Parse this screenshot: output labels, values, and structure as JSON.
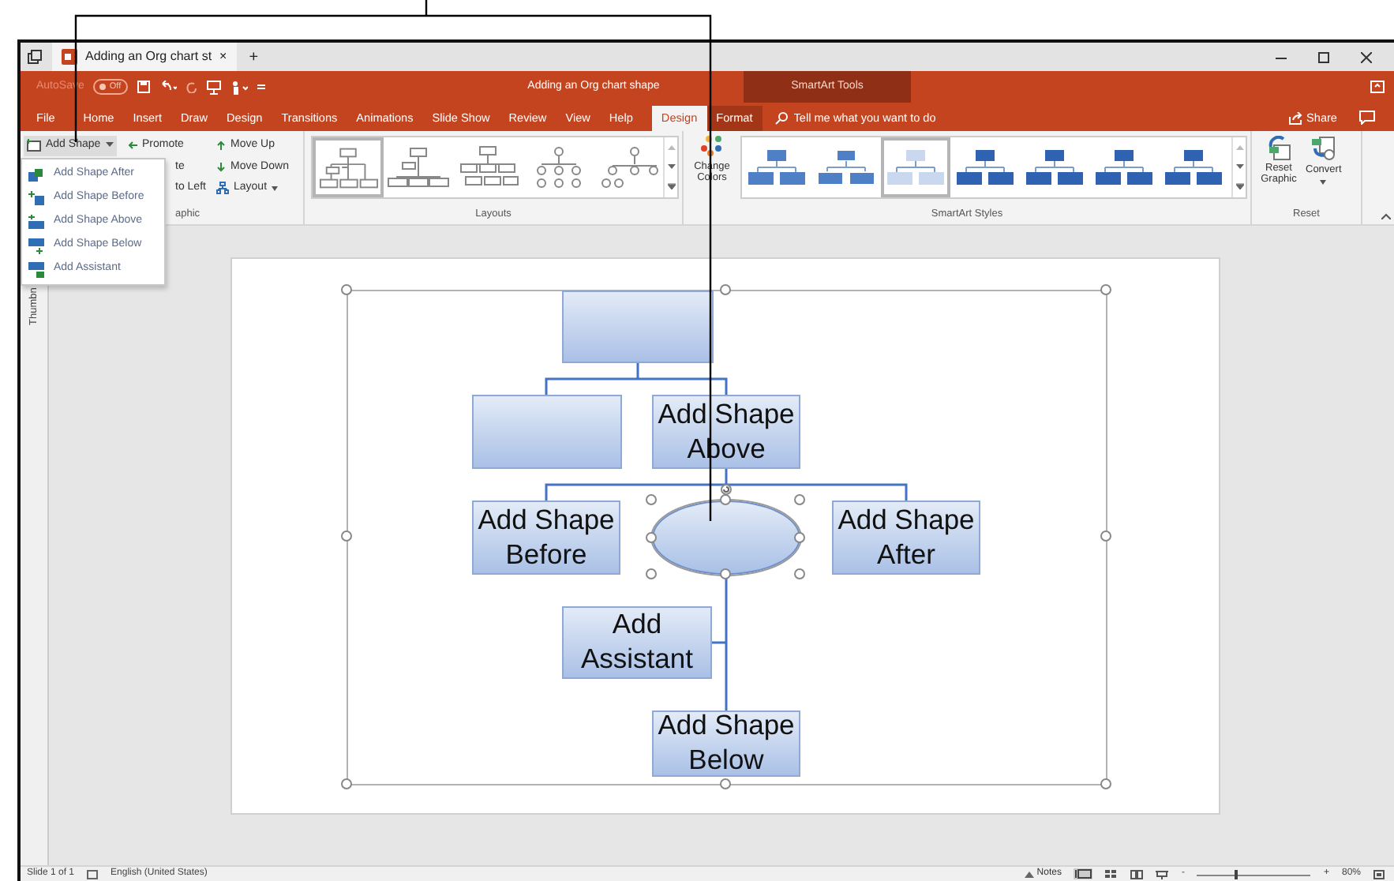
{
  "tab_bar": {
    "document_tab": "Adding an Org chart st",
    "close_glyph": "×",
    "new_tab": "+"
  },
  "title_bar": {
    "autosave_label": "AutoSave",
    "autosave_on": false,
    "autosave_state": "Off",
    "title": "Adding an Org chart shape",
    "contextual_label": "SmartArt Tools"
  },
  "ribbon_tabs": [
    {
      "label": "File",
      "selected": false,
      "kind": "main"
    },
    {
      "label": "Home",
      "selected": false,
      "kind": "main"
    },
    {
      "label": "Insert",
      "selected": false,
      "kind": "main"
    },
    {
      "label": "Draw",
      "selected": false,
      "kind": "main"
    },
    {
      "label": "Design",
      "selected": false,
      "kind": "main"
    },
    {
      "label": "Transitions",
      "selected": false,
      "kind": "main"
    },
    {
      "label": "Animations",
      "selected": false,
      "kind": "main"
    },
    {
      "label": "Slide Show",
      "selected": false,
      "kind": "main"
    },
    {
      "label": "Review",
      "selected": false,
      "kind": "main"
    },
    {
      "label": "View",
      "selected": false,
      "kind": "main"
    },
    {
      "label": "Help",
      "selected": false,
      "kind": "main"
    },
    {
      "label": "Design",
      "selected": true,
      "kind": "contextual"
    },
    {
      "label": "Format",
      "selected": false,
      "kind": "contextual"
    }
  ],
  "search": {
    "placeholder": "Tell me what you want to do"
  },
  "share": "Share",
  "create_graphic": {
    "add_shape": "Add Shape",
    "promote": "Promote",
    "demote": "te",
    "right_to_left": "to Left",
    "move_up": "Move Up",
    "move_down": "Move Down",
    "layout": "Layout",
    "group_label": "aphic"
  },
  "layouts": {
    "group_label": "Layouts",
    "items": [
      {
        "selected": true
      },
      {
        "selected": false
      },
      {
        "selected": false
      },
      {
        "selected": false
      },
      {
        "selected": false
      }
    ]
  },
  "smartart_styles": {
    "change_colors": "Change Colors",
    "group_label": "SmartArt Styles",
    "items": [
      {
        "selected": false
      },
      {
        "selected": false
      },
      {
        "selected": true
      },
      {
        "selected": false
      },
      {
        "selected": false
      },
      {
        "selected": false
      },
      {
        "selected": false
      }
    ]
  },
  "reset": {
    "reset_graphic": "Reset Graphic",
    "convert": "Convert",
    "group_label": "Reset"
  },
  "add_shape_menu": [
    {
      "label": "Add Shape After"
    },
    {
      "label": "Add Shape Before"
    },
    {
      "label": "Add Shape Above"
    },
    {
      "label": "Add Shape Below"
    },
    {
      "label": "Add Assistant"
    }
  ],
  "thumbnails_label": "Thumbn",
  "slide": {
    "nodes": [
      {
        "kind": "rect",
        "selected": false
      },
      {
        "kind": "rect",
        "selected": false
      },
      {
        "kind": "rect",
        "text": "Add Shape Above",
        "selected": false
      },
      {
        "kind": "rect",
        "text": "Add Shape Before",
        "selected": false
      },
      {
        "kind": "ellipse",
        "selected": true
      },
      {
        "kind": "rect",
        "text": "Add Shape After",
        "selected": false
      },
      {
        "kind": "rect",
        "text": "Add Assistant",
        "selected": false
      },
      {
        "kind": "rect",
        "text": "Add Shape Below",
        "selected": false
      }
    ]
  },
  "status_bar": {
    "slide": "Slide 1 of 1",
    "language": "English (United States)",
    "notes": "Notes",
    "zoom_minus": "-",
    "zoom_plus": "+",
    "zoom": {
      "level": 0.33
    },
    "zoom_label": "80%"
  }
}
